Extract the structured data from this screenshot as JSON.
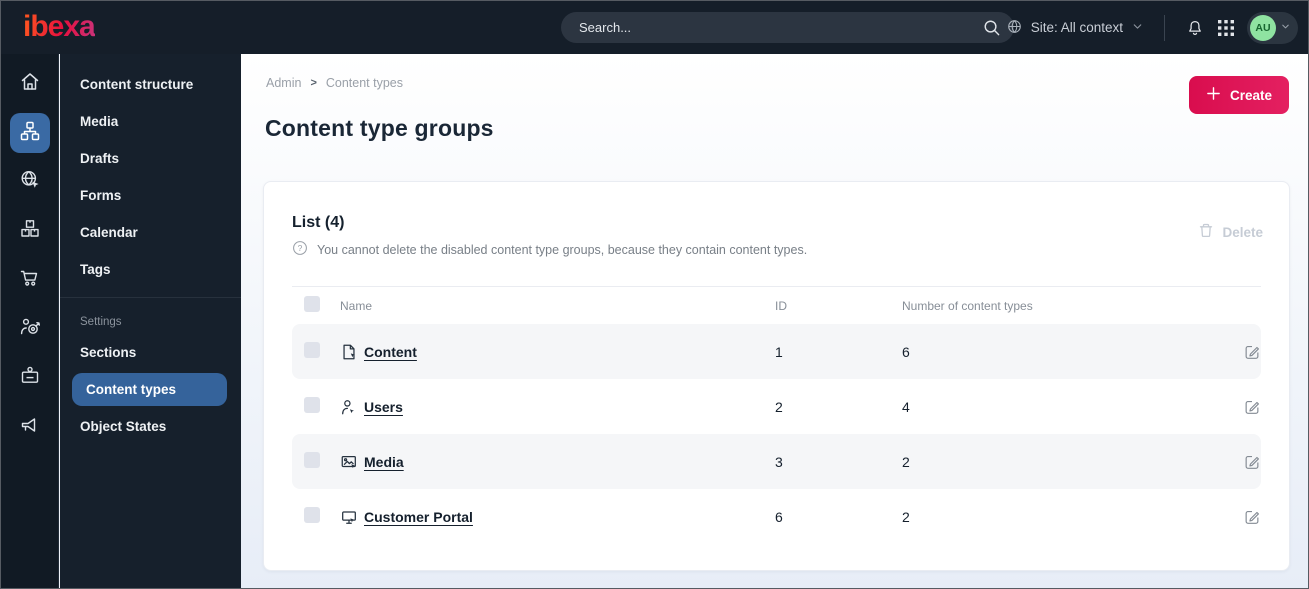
{
  "topbar": {
    "brand": "ibexa",
    "search_placeholder": "Search...",
    "site_context": "Site: All context",
    "avatar_initials": "AU"
  },
  "breadcrumb": {
    "items": [
      "Admin",
      "Content types"
    ],
    "separator": ">"
  },
  "page": {
    "title": "Content type groups",
    "create_label": "Create"
  },
  "list": {
    "title": "List (4)",
    "hint": "You cannot delete the disabled content type groups, because they contain content types.",
    "delete_label": "Delete"
  },
  "table": {
    "columns": {
      "name": "Name",
      "id": "ID",
      "count": "Number of content types"
    },
    "rows": [
      {
        "name": "Content",
        "id": "1",
        "count": "6",
        "icon": "file-icon"
      },
      {
        "name": "Users",
        "id": "2",
        "count": "4",
        "icon": "user-icon"
      },
      {
        "name": "Media",
        "id": "3",
        "count": "2",
        "icon": "image-icon"
      },
      {
        "name": "Customer Portal",
        "id": "6",
        "count": "2",
        "icon": "monitor-icon"
      }
    ]
  },
  "sidebar": {
    "main_items": [
      "Content structure",
      "Media",
      "Drafts",
      "Forms",
      "Calendar",
      "Tags"
    ],
    "settings_label": "Settings",
    "settings_items": [
      "Sections",
      "Content types",
      "Object States"
    ],
    "active_item": "Content types"
  },
  "colors": {
    "accent_pink": "#e0195c",
    "active_blue": "#35639b",
    "avatar_green": "#8fe3a1",
    "dark_navy": "#151e29"
  }
}
